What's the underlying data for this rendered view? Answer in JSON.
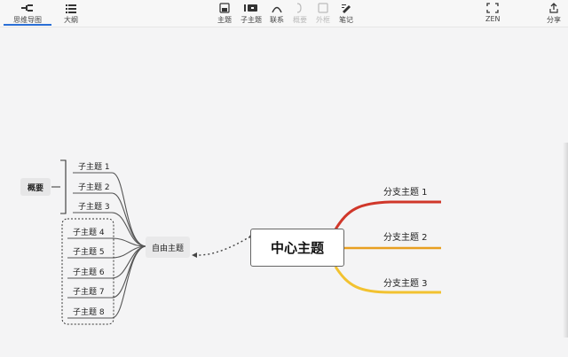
{
  "toolbar": {
    "left_tabs": [
      {
        "label": "思维导图",
        "icon": "mindmap-icon"
      },
      {
        "label": "大纲",
        "icon": "outline-icon"
      }
    ],
    "tools": [
      {
        "label": "主题",
        "icon": "topic-icon",
        "enabled": true
      },
      {
        "label": "子主题",
        "icon": "subtopic-icon",
        "enabled": true
      },
      {
        "label": "联系",
        "icon": "relationship-icon",
        "enabled": true
      },
      {
        "label": "概要",
        "icon": "summary-icon",
        "enabled": false
      },
      {
        "label": "外框",
        "icon": "boundary-icon",
        "enabled": false
      },
      {
        "label": "笔记",
        "icon": "note-icon",
        "enabled": true
      }
    ],
    "zen_label": "ZEN",
    "share_label": "分享"
  },
  "map": {
    "central_topic": "中心主题",
    "branches": [
      {
        "label": "分支主题 1",
        "color": "#d0372a"
      },
      {
        "label": "分支主题 2",
        "color": "#e89f20"
      },
      {
        "label": "分支主题 3",
        "color": "#f2c230"
      }
    ],
    "floating_topic": "自由主题",
    "subtopics": [
      "子主题 1",
      "子主题 2",
      "子主题 3",
      "子主题 4",
      "子主题 5",
      "子主题 6",
      "子主题 7",
      "子主题 8"
    ],
    "summary_label": "概要"
  }
}
